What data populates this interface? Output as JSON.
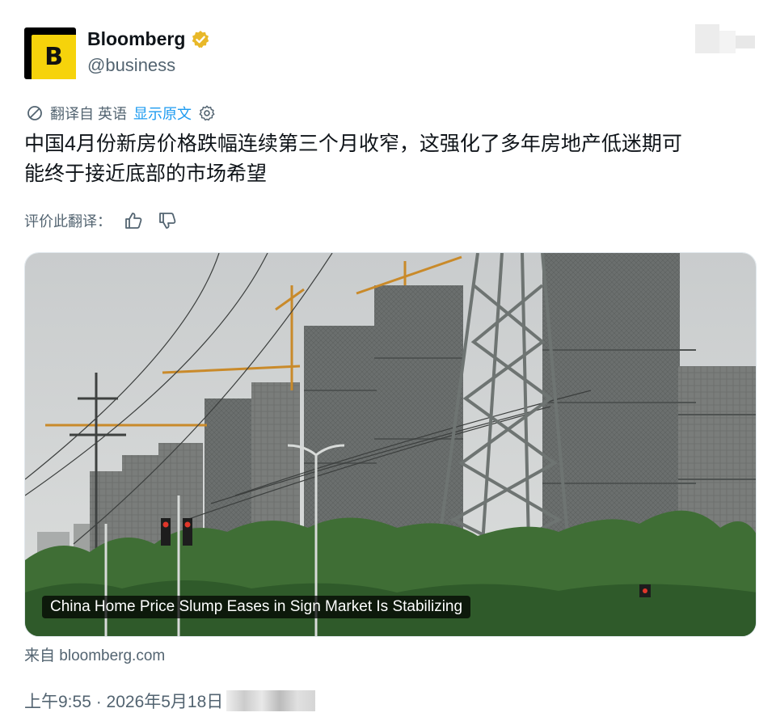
{
  "author": {
    "name": "Bloomberg",
    "handle": "@business",
    "avatar_letter": "B",
    "avatar_color": "#f6d30b",
    "verified_color": "#e8b829"
  },
  "translation": {
    "label": "翻译自 英语",
    "show_original": "显示原文",
    "icon": "translate-icon",
    "settings_icon": "gear-icon"
  },
  "tweet": {
    "text_line1": "中国4月份新房价格跌幅连续第三个月收窄，这强化了多年房地产低迷期可",
    "text_line2": "能终于接近底部的市场希望"
  },
  "rating": {
    "label": "评价此翻译：",
    "up_icon": "thumbs-up-icon",
    "down_icon": "thumbs-down-icon"
  },
  "card": {
    "caption": "China Home Price Slump Eases in Sign Market Is Stabilizing",
    "source": "来自 bloomberg.com"
  },
  "meta": {
    "time_date": "上午9:55 · 2026年5月18日"
  },
  "colors": {
    "link": "#1d9bf0",
    "secondary_text": "#536471"
  }
}
